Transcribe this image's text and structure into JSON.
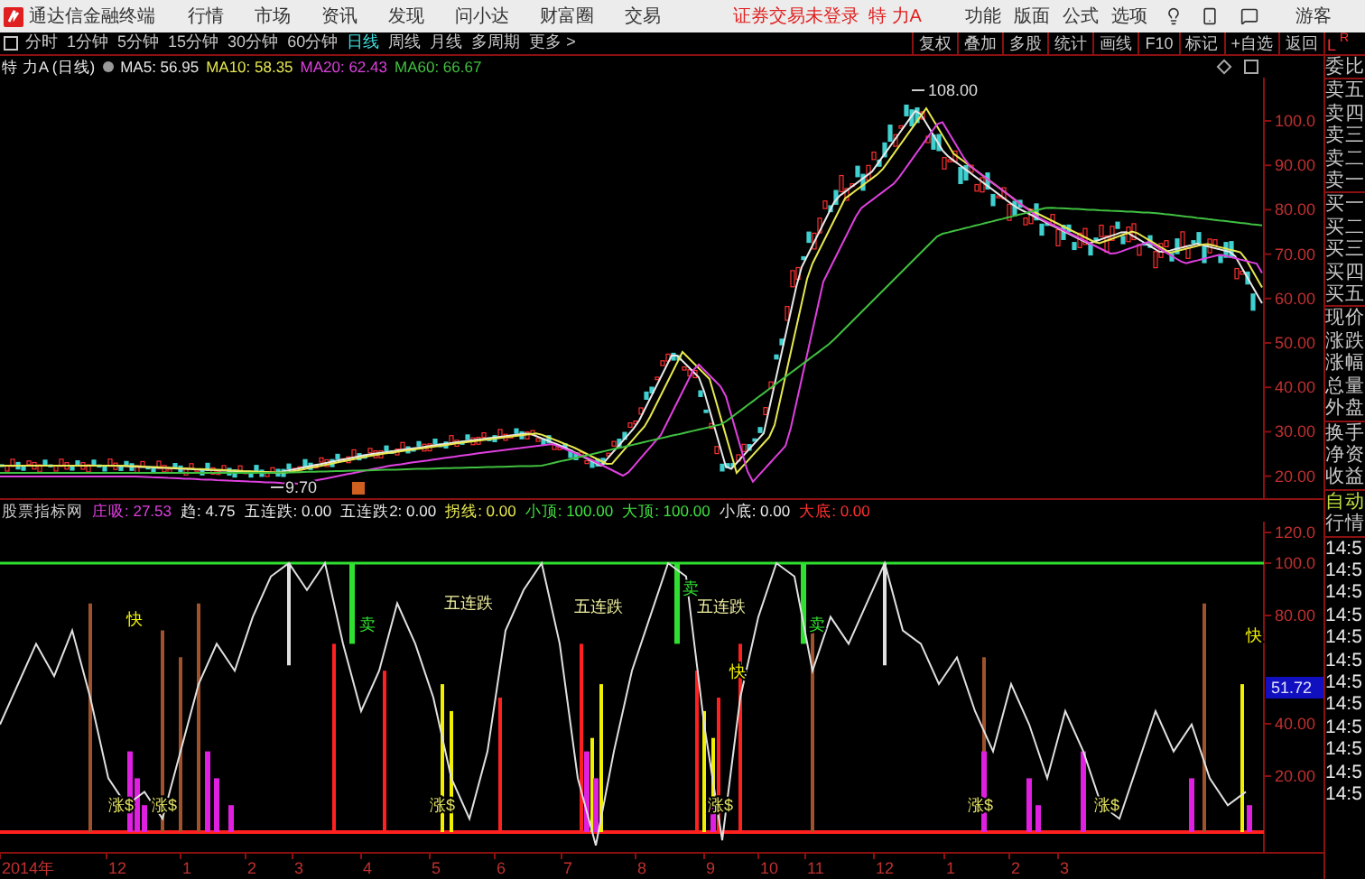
{
  "app": {
    "title": "通达信金融终端"
  },
  "menu": [
    "行情",
    "市场",
    "资讯",
    "发现",
    "问小达",
    "财富圈",
    "交易"
  ],
  "login_status": "证券交易未登录",
  "stock_name": "特 力A",
  "top_actions": [
    "功能",
    "版面",
    "公式",
    "选项"
  ],
  "user": "游客",
  "periods": [
    {
      "label": "分时",
      "selected": false
    },
    {
      "label": "1分钟",
      "selected": false
    },
    {
      "label": "5分钟",
      "selected": false
    },
    {
      "label": "15分钟",
      "selected": false
    },
    {
      "label": "30分钟",
      "selected": false
    },
    {
      "label": "60分钟",
      "selected": false
    },
    {
      "label": "日线",
      "selected": true
    },
    {
      "label": "周线",
      "selected": false
    },
    {
      "label": "月线",
      "selected": false
    },
    {
      "label": "多周期",
      "selected": false
    }
  ],
  "more": "更多 >",
  "tools": [
    "复权",
    "叠加",
    "多股",
    "统计",
    "画线",
    "F10",
    "标记",
    "+自选",
    "返回"
  ],
  "main_chart": {
    "title": "特 力A (日线)",
    "ma": [
      {
        "label": "MA5: 56.95",
        "color": "#e8e8e8"
      },
      {
        "label": "MA10: 58.35",
        "color": "#e8e850"
      },
      {
        "label": "MA20: 62.43",
        "color": "#e040e0"
      },
      {
        "label": "MA60: 66.67",
        "color": "#40c040"
      }
    ],
    "high_label": "108.00",
    "low_label": "9.70",
    "yticks": [
      "100.0",
      "90.00",
      "80.00",
      "70.00",
      "60.00",
      "50.00",
      "40.00",
      "30.00",
      "20.00"
    ]
  },
  "indicator": {
    "name": "股票指标网",
    "values": [
      {
        "label": "庄吸: 27.53",
        "color": "#e040e0"
      },
      {
        "label": "趋: 4.75",
        "color": "#e8e8e8"
      },
      {
        "label": "五连跌: 0.00",
        "color": "#e8e8e8"
      },
      {
        "label": "五连跌2: 0.00",
        "color": "#e8e8e8"
      },
      {
        "label": "拐线: 0.00",
        "color": "#e8e850"
      },
      {
        "label": "小顶: 100.00",
        "color": "#40e040"
      },
      {
        "label": "大顶: 100.00",
        "color": "#40e040"
      },
      {
        "label": "小底: 0.00",
        "color": "#e8e8e8"
      },
      {
        "label": "大底: 0.00",
        "color": "#ff3030"
      }
    ],
    "yticks": [
      "120.0",
      "100.0",
      "80.00",
      "40.00",
      "20.00"
    ],
    "current": "51.72",
    "signals": [
      {
        "text": "涨$",
        "kind": "rise"
      },
      {
        "text": "快",
        "kind": "fast"
      },
      {
        "text": "涨$",
        "kind": "rise"
      },
      {
        "text": "卖",
        "kind": "sell"
      },
      {
        "text": "涨$",
        "kind": "rise"
      },
      {
        "text": "五连跌",
        "kind": "drop"
      },
      {
        "text": "五连跌",
        "kind": "drop"
      },
      {
        "text": "卖",
        "kind": "sell"
      },
      {
        "text": "五连跌",
        "kind": "drop"
      },
      {
        "text": "涨$",
        "kind": "rise"
      },
      {
        "text": "快",
        "kind": "fast"
      },
      {
        "text": "卖",
        "kind": "sell"
      },
      {
        "text": "涨$",
        "kind": "rise"
      },
      {
        "text": "涨$",
        "kind": "rise"
      },
      {
        "text": "快",
        "kind": "fast"
      }
    ]
  },
  "time_axis": [
    "2014年",
    "12",
    "1",
    "2",
    "3",
    "4",
    "5",
    "6",
    "7",
    "8",
    "9",
    "10",
    "11",
    "12",
    "1",
    "2",
    "3"
  ],
  "quote_panel": {
    "header_left": "L",
    "header_right": "R",
    "groups": [
      [
        "委比"
      ],
      [
        "卖五",
        "卖四",
        "卖三",
        "卖二",
        "卖一"
      ],
      [
        "买一",
        "买二",
        "买三",
        "买四",
        "买五"
      ],
      [
        "现价",
        "涨跌",
        "涨幅",
        "总量",
        "外盘"
      ],
      [
        "换手",
        "净资",
        "收益"
      ],
      [
        "自动",
        "行情"
      ]
    ],
    "times": [
      "14:5",
      "14:5",
      "14:5",
      "14:5",
      "14:5",
      "14:5",
      "14:5",
      "14:5",
      "14:5",
      "14:5",
      "14:5",
      "14:5"
    ]
  }
}
